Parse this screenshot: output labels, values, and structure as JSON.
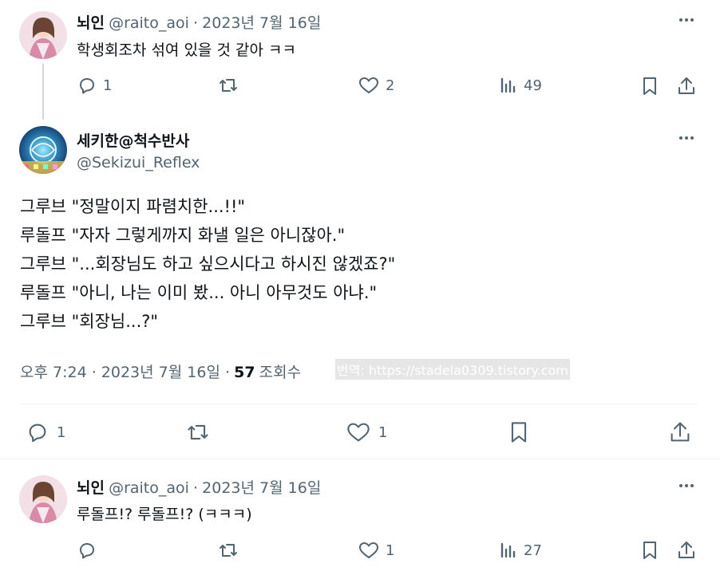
{
  "tweet1": {
    "display_name": "뇌인",
    "handle": "@raito_aoi",
    "date": "2023년 7월 16일",
    "separator": "·",
    "text": "학생회조차 섞여 있을 것 같아 ㅋㅋ",
    "reply_count": "1",
    "retweet_count": "",
    "like_count": "2",
    "view_count": "49",
    "more_icon": "more-dots-icon"
  },
  "main_tweet": {
    "display_name": "세키한@척수반사",
    "handle": "@Sekizui_Reflex",
    "lines": [
      "그루브 \"정말이지 파렴치한...!!\"",
      "루돌프 \"자자 그렇게까지 화낼 일은 아니잖아.\"",
      "그루브 \"...회장님도 하고 싶으시다고 하시진 않겠죠?\"",
      "루돌프 \"아니, 나는 이미 봤... 아니 아무것도 아냐.\"",
      "그루브 \"회장님...?\""
    ],
    "time": "오후 7:24 · 2023년 7월 16일 ·",
    "views_number": "57",
    "views_label": "조회수",
    "reply_count": "1",
    "like_count": "1",
    "watermark": "번역: https://stadela0309.tistory.com"
  },
  "tweet3": {
    "display_name": "뇌인",
    "handle": "@raito_aoi",
    "date": "2023년 7월 16일",
    "separator": "·",
    "text": "루돌프!? 루돌프!? (ㅋㅋㅋ)",
    "reply_count": "",
    "retweet_count": "",
    "like_count": "1",
    "view_count": "27"
  },
  "colors": {
    "text": "#0f1419",
    "secondary": "#536471",
    "divider": "#eff3f4",
    "thread_line": "#cfd9de"
  }
}
